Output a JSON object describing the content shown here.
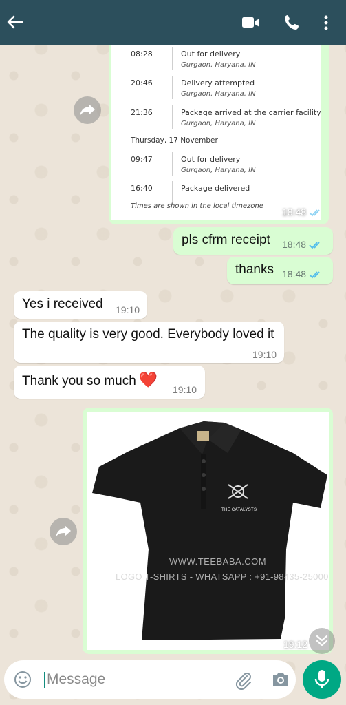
{
  "colors": {
    "header": "#2c4f5c",
    "outgoing": "#d9fdd3",
    "incoming": "#ffffff",
    "accent": "#00a884",
    "read_ticks": "#53bdeb"
  },
  "header": {
    "back_icon": "arrow-left-icon",
    "video_icon": "video-camera-icon",
    "call_icon": "phone-icon",
    "menu_icon": "more-vertical-icon"
  },
  "tracking": {
    "rows": [
      {
        "time": "08:28",
        "event": "Out for delivery",
        "location": "Gurgaon, Haryana, IN"
      },
      {
        "time": "20:46",
        "event": "Delivery attempted",
        "location": "Gurgaon, Haryana, IN"
      },
      {
        "time": "21:36",
        "event": "Package arrived at the carrier facility",
        "location": "Gurgaon, Haryana, IN"
      },
      {
        "time": "09:47",
        "event": "Out for delivery",
        "location": "Gurgaon, Haryana, IN"
      },
      {
        "time": "16:40",
        "event": "Package delivered",
        "location": ""
      }
    ],
    "date_heading": "Thursday, 17 November",
    "note": "Times are shown in the local timezone",
    "sent_time": "18:48"
  },
  "messages": [
    {
      "direction": "out",
      "text": "pls cfrm receipt",
      "time": "18:48",
      "read": true
    },
    {
      "direction": "out",
      "text": "thanks",
      "time": "18:48",
      "read": true
    },
    {
      "direction": "in",
      "text": "Yes i received",
      "time": "19:10"
    },
    {
      "direction": "in",
      "text": "The quality is very good. Everybody loved it",
      "time": "19:10"
    },
    {
      "direction": "in",
      "text": "Thank you so much",
      "emoji": "❤️",
      "time": "19:10"
    }
  ],
  "photo": {
    "watermark_line1": "WWW.TEEBABA.COM",
    "watermark_line2": "LOGO T-SHIRTS - WHATSAPP : +91-98435-25000",
    "logo_text": "THE CATALYSTS",
    "time": "19:12"
  },
  "composer": {
    "placeholder": "Message",
    "emoji_icon": "smiley-icon",
    "attach_icon": "paperclip-icon",
    "camera_icon": "camera-icon",
    "mic_icon": "microphone-icon"
  }
}
